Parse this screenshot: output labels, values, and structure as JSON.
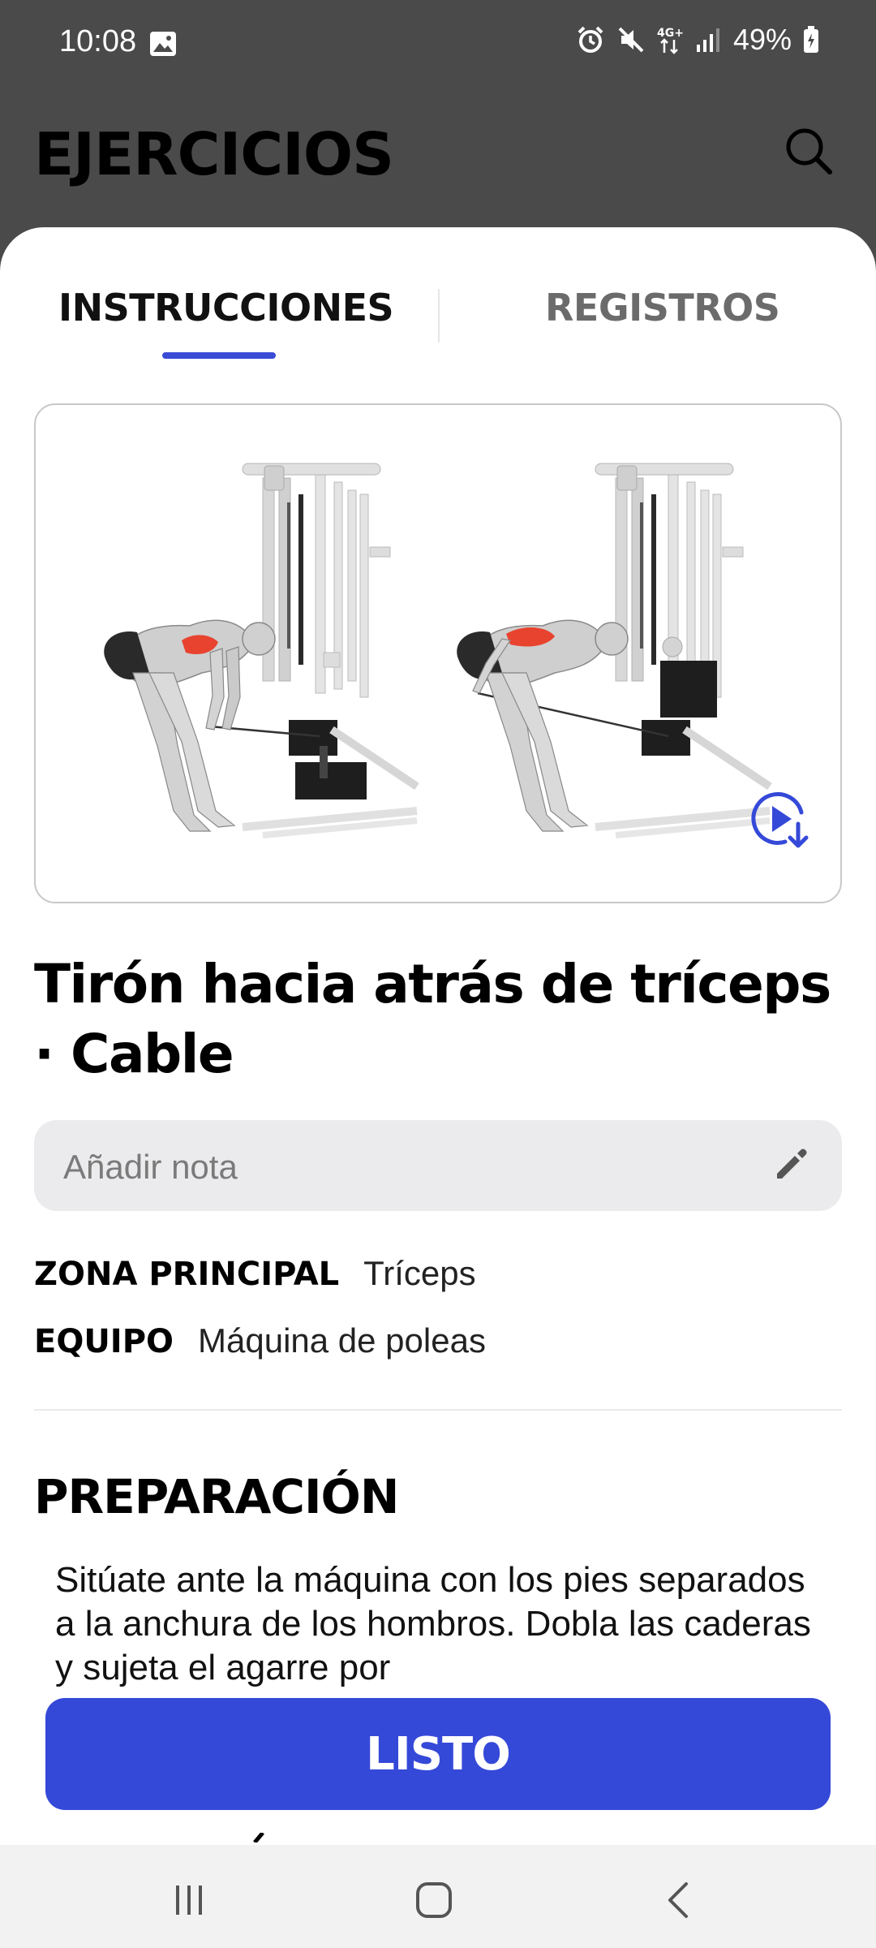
{
  "status_bar": {
    "time": "10:08",
    "battery": "49%",
    "icons": [
      "image-icon",
      "alarm-icon",
      "mute-icon",
      "4g-icon",
      "signal-icon",
      "battery-icon"
    ]
  },
  "header": {
    "title": "EJERCICIOS",
    "search_icon": "search-icon"
  },
  "tabs": [
    {
      "label": "INSTRUCCIONES",
      "active": true
    },
    {
      "label": "REGISTROS",
      "active": false
    }
  ],
  "exercise": {
    "title": "Tirón hacia atrás de tríceps · Cable",
    "note_placeholder": "Añadir nota",
    "primary_zone_label": "ZONA PRINCIPAL",
    "primary_zone_value": "Tríceps",
    "equipment_label": "EQUIPO",
    "equipment_value": "Máquina de poleas"
  },
  "preparation": {
    "title": "PREPARACIÓN",
    "body": "Sitúate ante la máquina con los pies separados a la anchura de los hombros. Dobla las caderas y sujeta el agarre por"
  },
  "done_button": "LISTO",
  "colors": {
    "accent": "#3549d8",
    "header_bg": "#4a4a4a",
    "muscle_highlight": "#e8432f"
  }
}
